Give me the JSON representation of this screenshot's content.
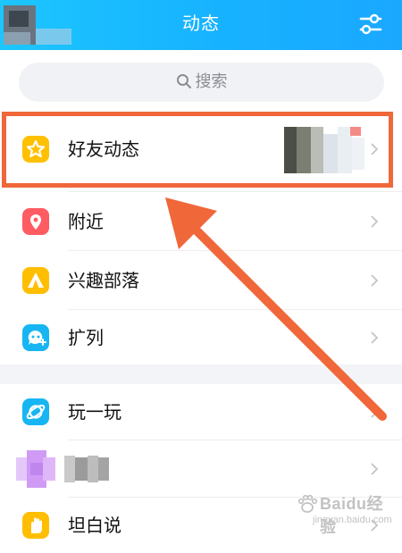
{
  "header": {
    "title": "动态",
    "settings_icon": "sliders-icon",
    "gradient_colors": [
      "#1cc6ff",
      "#1aa8ff"
    ]
  },
  "search": {
    "placeholder": "搜索",
    "icon": "search-icon"
  },
  "menu": {
    "items": [
      {
        "label": "好友动态",
        "icon": "star-icon",
        "color": "#ffc000"
      },
      {
        "label": "附近",
        "icon": "location-pin-icon",
        "color": "#ff5b63"
      },
      {
        "label": "兴趣部落",
        "icon": "tent-icon",
        "color": "#ffbe00"
      },
      {
        "label": "扩列",
        "icon": "chat-bubble-icon",
        "color": "#17b6f2"
      },
      {
        "label": "玩一玩",
        "icon": "planet-icon",
        "color": "#17b6f2"
      },
      {
        "label": "",
        "icon": "blurred-app-icon",
        "color": "#d7a8f7"
      },
      {
        "label": "坦白说",
        "icon": "hand-icon",
        "color": "#ffbe00"
      }
    ]
  },
  "annotation": {
    "highlight_color": "#f0673a",
    "arrow_color": "#f0673a",
    "highlighted_item": "好友动态"
  },
  "watermark": {
    "text": "Baidu经验",
    "subtext": "jingyan.baidu.com"
  }
}
